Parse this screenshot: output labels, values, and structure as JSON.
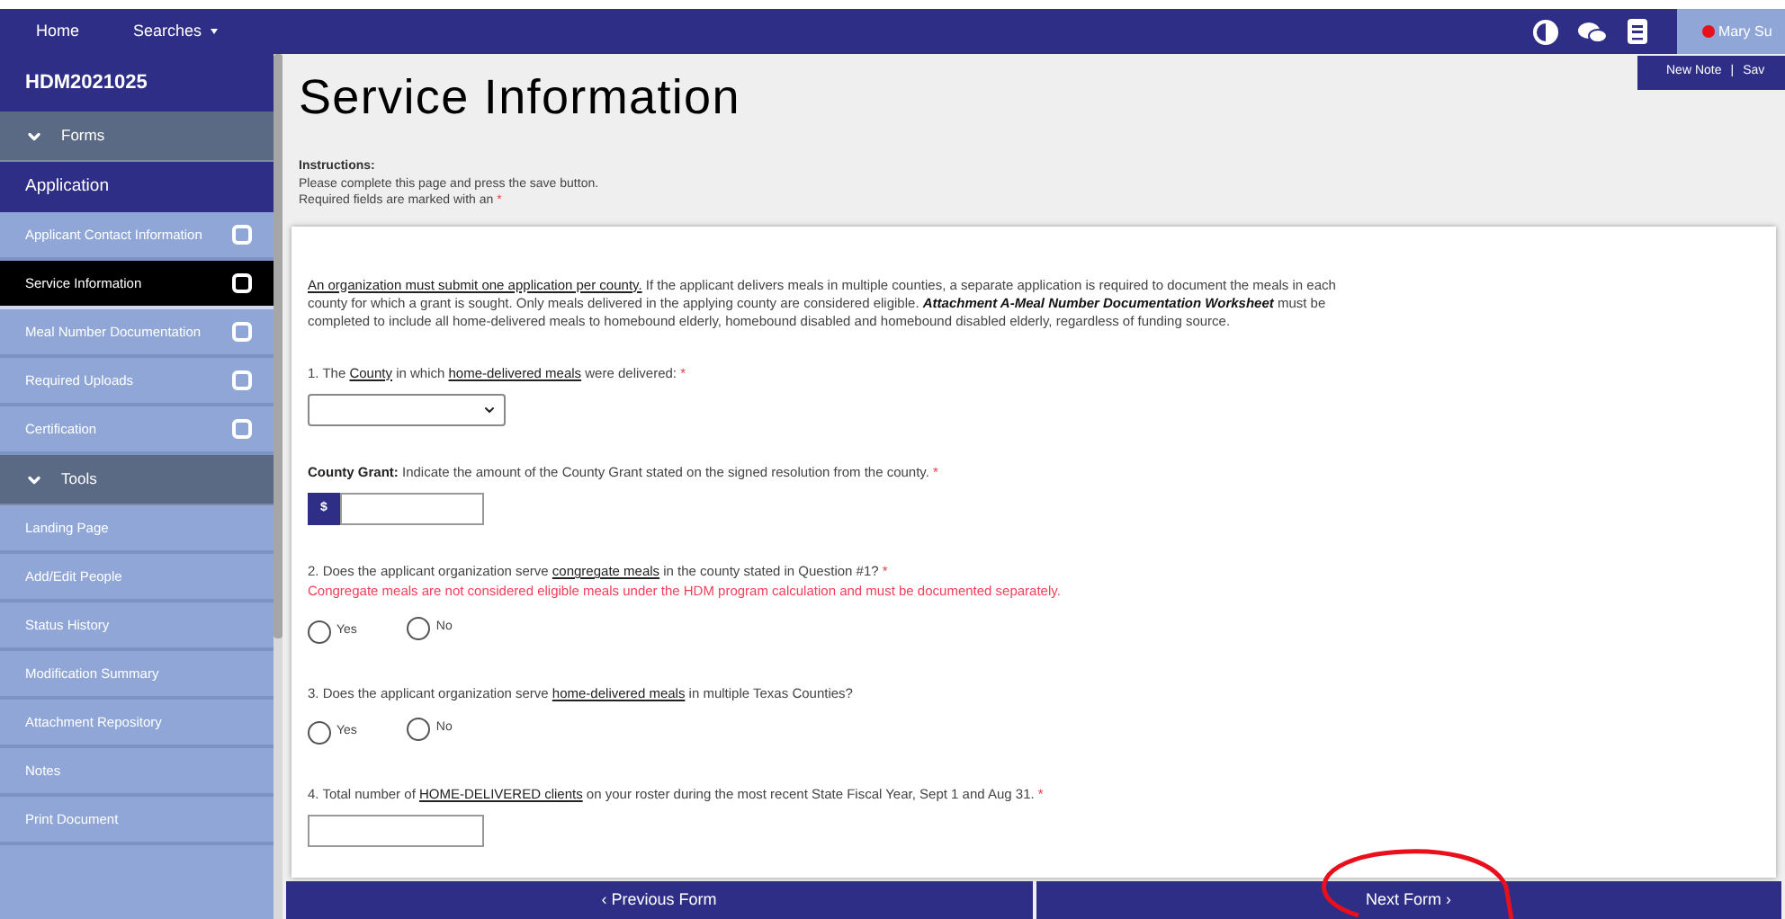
{
  "nav": {
    "links": [
      {
        "label": "Home",
        "caret": false
      },
      {
        "label": "Searches",
        "caret": true
      }
    ],
    "user": {
      "name": "Mary Su"
    },
    "user_menu": [
      "New Note",
      "Sav"
    ],
    "menu_separator": "|"
  },
  "sidebar": {
    "title": "HDM2021025",
    "sections": [
      {
        "label": "Forms",
        "expanded": true,
        "group": "Application",
        "items": [
          {
            "label": "Applicant Contact Information",
            "selected": false,
            "checkbox": true
          },
          {
            "label": "Service Information",
            "selected": true,
            "checkbox": true
          },
          {
            "label": "Meal Number Documentation",
            "selected": false,
            "checkbox": true
          },
          {
            "label": "Required Uploads",
            "selected": false,
            "checkbox": true
          },
          {
            "label": "Certification",
            "selected": false,
            "checkbox": true
          }
        ]
      },
      {
        "label": "Tools",
        "expanded": true,
        "items": [
          {
            "label": "Landing Page",
            "selected": false,
            "checkbox": false
          },
          {
            "label": "Add/Edit People",
            "selected": false,
            "checkbox": false
          },
          {
            "label": "Status History",
            "selected": false,
            "checkbox": false
          },
          {
            "label": "Modification Summary",
            "selected": false,
            "checkbox": false
          },
          {
            "label": "Attachment Repository",
            "selected": false,
            "checkbox": false
          },
          {
            "label": "Notes",
            "selected": false,
            "checkbox": false
          },
          {
            "label": "Print Document",
            "selected": false,
            "checkbox": false
          }
        ]
      }
    ]
  },
  "page": {
    "title": "Service Information",
    "instructions_heading": "Instructions:",
    "instructions": [
      "Please complete this page and press the save button.",
      "Required fields are marked with an"
    ],
    "required_mark": "*"
  },
  "form": {
    "intro": [
      {
        "text": "An organization must submit one application per county.",
        "kind": "link"
      },
      {
        "text": " If the applicant delivers meals in multiple counties, a separate application is required to document the meals in each county for which a grant is sought. Only meals delivered in the applying county are considered eligible. ",
        "kind": "text"
      },
      {
        "text": "Attachment A-Meal Number Documentation Worksheet",
        "kind": "emphasis"
      },
      {
        "text": " must be completed to include all home-delivered meals to homebound elderly, homebound disabled and homebound disabled elderly, regardless of funding source.",
        "kind": "text"
      }
    ],
    "questions": [
      {
        "kind": "select",
        "label": [
          {
            "text": "1. The ",
            "kind": "text"
          },
          {
            "text": "County",
            "kind": "link"
          },
          {
            "text": " in which ",
            "kind": "text"
          },
          {
            "text": "home-delivered meals",
            "kind": "link"
          },
          {
            "text": " were delivered:",
            "kind": "text"
          }
        ],
        "required": true
      },
      {
        "kind": "currency",
        "label": [
          {
            "text": "County Grant:",
            "kind": "heading"
          },
          {
            "text": " Indicate the amount of the County Grant stated on the signed resolution from the county.",
            "kind": "text"
          }
        ],
        "required": true,
        "prefix": "$"
      },
      {
        "kind": "radio",
        "label": [
          {
            "text": "2. Does the applicant organization serve ",
            "kind": "text"
          },
          {
            "text": "congregate meals",
            "kind": "link"
          },
          {
            "text": " in the county stated in Question #1?",
            "kind": "text"
          }
        ],
        "required": true,
        "note": "Congregate meals are not considered eligible meals under the HDM program calculation and must be documented separately.",
        "options": [
          {
            "label": "Yes",
            "selected": false
          },
          {
            "label": "No",
            "selected": false
          }
        ]
      },
      {
        "kind": "radio",
        "label": [
          {
            "text": "3. Does the applicant organization serve ",
            "kind": "text"
          },
          {
            "text": "home-delivered meals",
            "kind": "link"
          },
          {
            "text": " in multiple Texas Counties?",
            "kind": "text"
          }
        ],
        "required": false,
        "options": [
          {
            "label": "Yes",
            "selected": false
          },
          {
            "label": "No",
            "selected": false
          }
        ]
      },
      {
        "kind": "text",
        "label": [
          {
            "text": "4. Total number of ",
            "kind": "text"
          },
          {
            "text": "HOME-DELIVERED clients",
            "kind": "link"
          },
          {
            "text": " on your roster during the most recent State Fiscal Year, Sept 1 and Aug 31.",
            "kind": "text"
          }
        ],
        "required": true
      }
    ]
  },
  "footer": {
    "previous": "‹ Previous Form",
    "next": "Next Form ›"
  }
}
